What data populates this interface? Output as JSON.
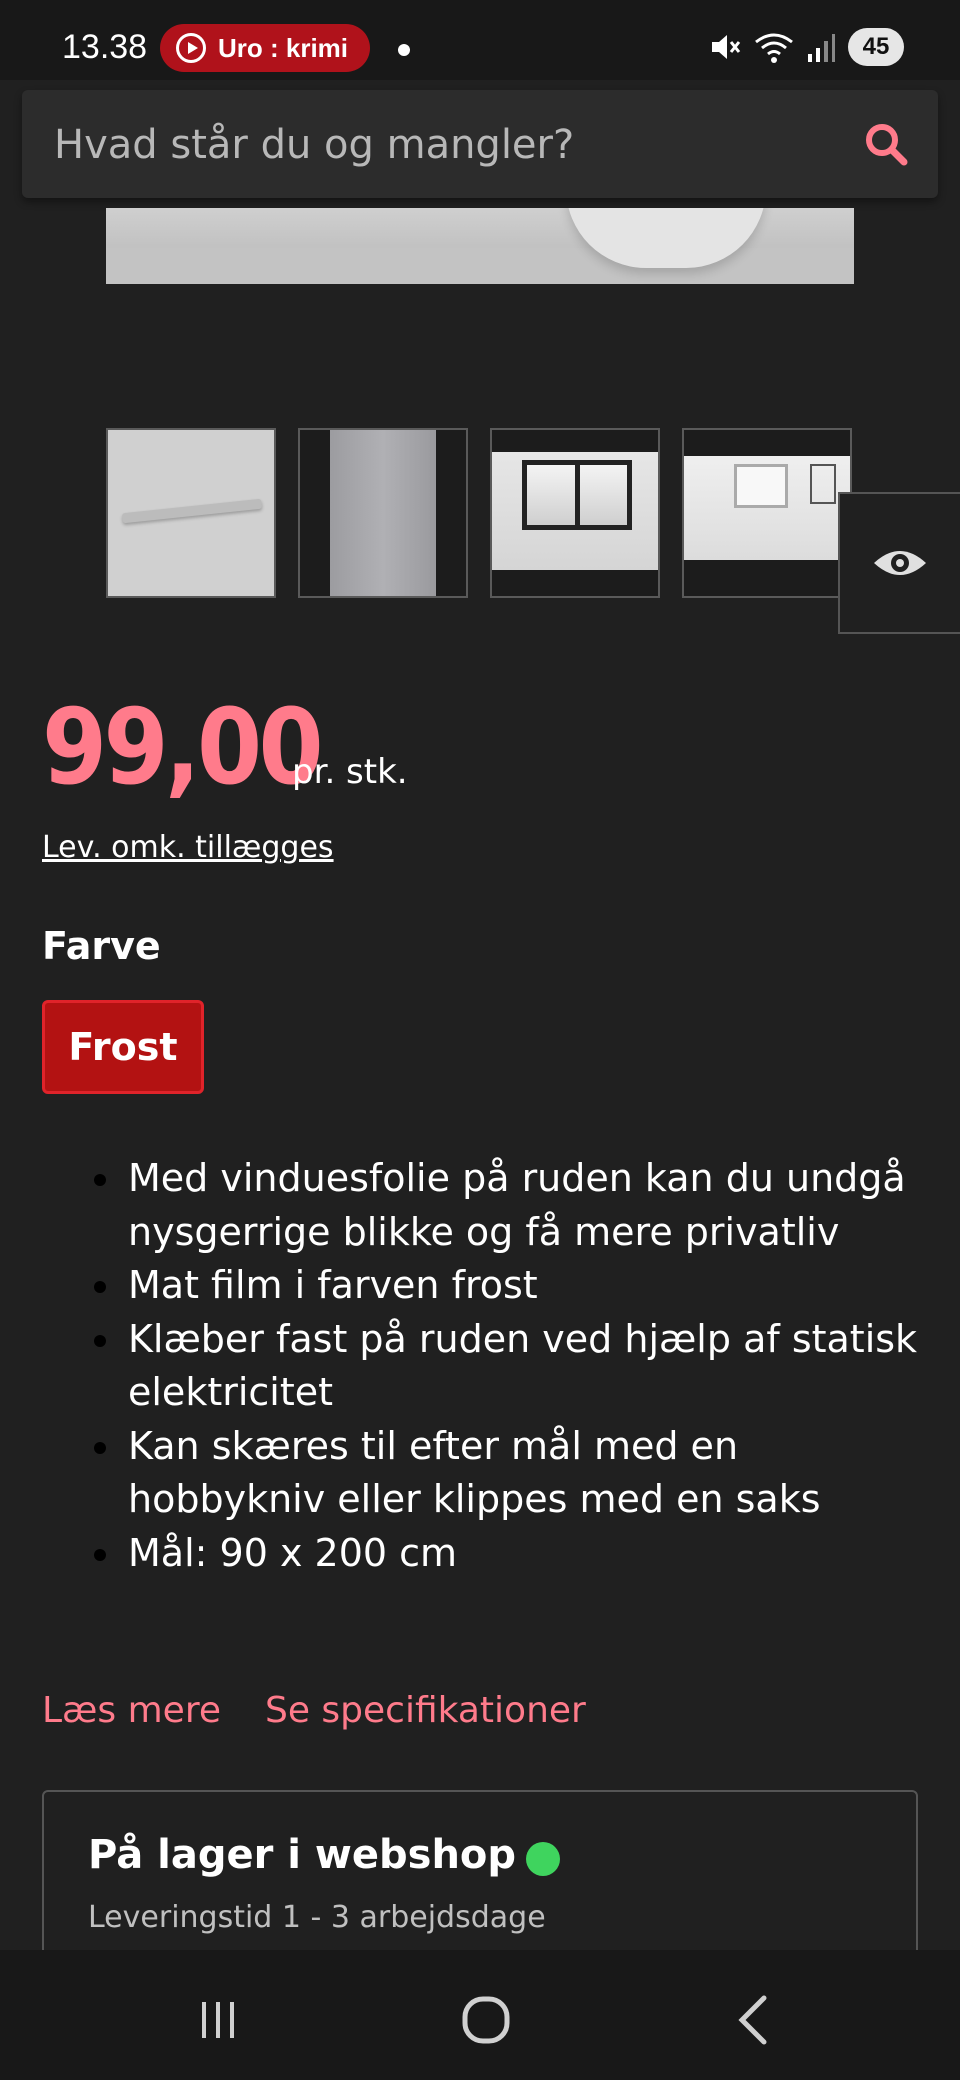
{
  "status_bar": {
    "time": "13.38",
    "media_label": "Uro : krimi",
    "battery": "45"
  },
  "search": {
    "placeholder": "Hvad står du og mangler?"
  },
  "product": {
    "price": "99,00",
    "price_unit": "pr. stk.",
    "shipping_note": "Lev. omk. tillægges",
    "color_label": "Farve",
    "color_option": "Frost",
    "features": [
      "Med vinduesfolie på ruden kan du undgå nysgerrige blikke og få mere privatliv",
      "Mat film i farven frost",
      "Klæber fast på ruden ved hjælp af statisk elektricitet",
      "Kan skæres til efter mål med en hobbykniv eller klippes med en saks",
      "Mål: 90 x 200 cm"
    ],
    "read_more": "Læs mere",
    "specifications": "Se specifikationer"
  },
  "stock": {
    "title": "På lager i webshop",
    "delivery": "Leveringstid 1 - 3 arbejdsdage"
  },
  "colors": {
    "accent": "#ff7b8b",
    "brand_red": "#b31212",
    "in_stock": "#3fd45e",
    "background": "#202020"
  },
  "icons": [
    "play-icon",
    "mute-icon",
    "wifi-icon",
    "signal-icon",
    "search-icon",
    "eye-icon",
    "recents-icon",
    "home-icon",
    "back-icon"
  ]
}
